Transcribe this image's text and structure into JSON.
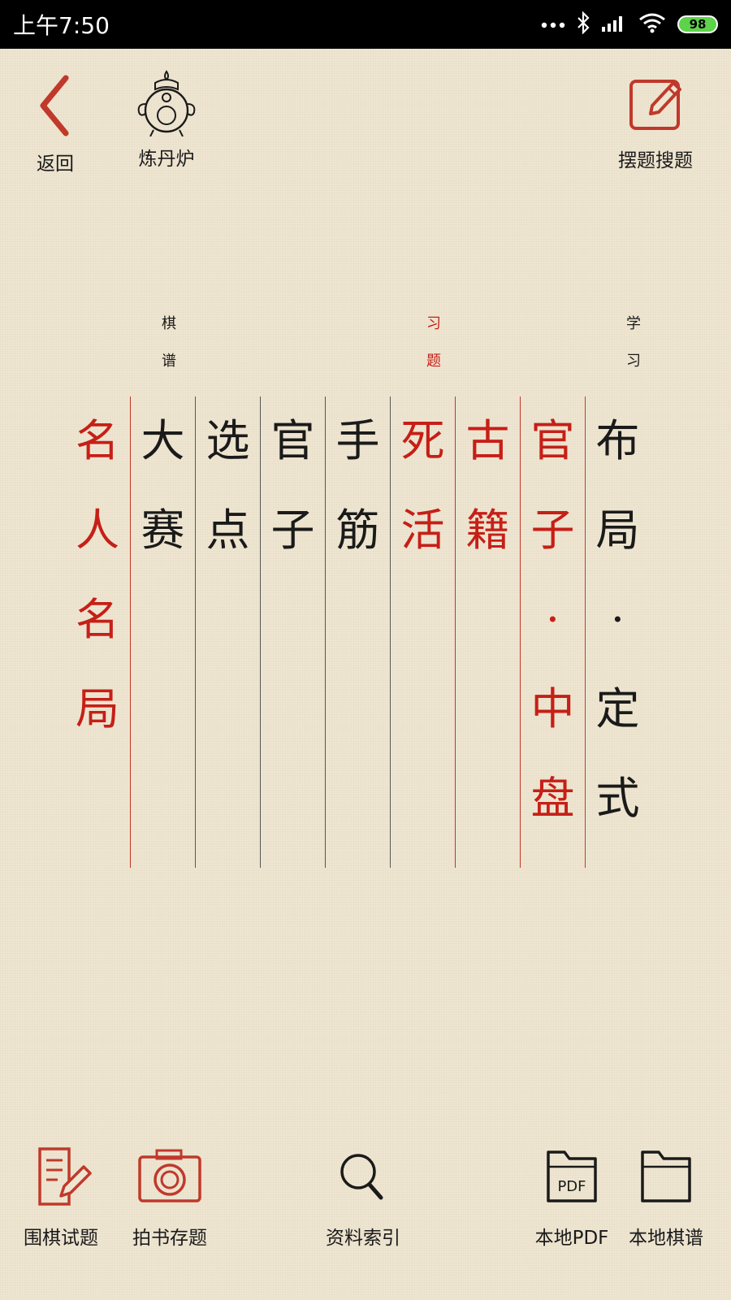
{
  "status_bar": {
    "time": "上午7:50",
    "battery": "98"
  },
  "header": {
    "back_label": "返回",
    "furnace_label": "炼丹炉",
    "search_label": "摆题搜题"
  },
  "menu": {
    "labels": {
      "qipu": [
        "棋",
        "谱"
      ],
      "xiti": [
        "习",
        "题"
      ],
      "xuexi": [
        "学",
        "习"
      ]
    },
    "columns": [
      {
        "chars": [
          "名",
          "人",
          "名",
          "局"
        ],
        "color": "red"
      },
      {
        "chars": [
          "大",
          "赛"
        ],
        "color": "black"
      },
      {
        "chars": [
          "选",
          "点"
        ],
        "color": "black"
      },
      {
        "chars": [
          "官",
          "子"
        ],
        "color": "black"
      },
      {
        "chars": [
          "手",
          "筋"
        ],
        "color": "black"
      },
      {
        "chars": [
          "死",
          "活"
        ],
        "color": "red"
      },
      {
        "chars": [
          "古",
          "籍"
        ],
        "color": "red"
      },
      {
        "chars": [
          "官",
          "子",
          "·",
          "中",
          "盘"
        ],
        "color": "red"
      },
      {
        "chars": [
          "布",
          "局",
          "·",
          "定",
          "式"
        ],
        "color": "black"
      }
    ]
  },
  "bottom_bar": {
    "items": [
      {
        "label": "围棋试题"
      },
      {
        "label": "拍书存题"
      },
      {
        "label": "资料索引"
      },
      {
        "label": "本地PDF",
        "pdf_text": "PDF"
      },
      {
        "label": "本地棋谱"
      }
    ]
  },
  "colors": {
    "accent": "#c61f17",
    "ink": "#1a1a1a",
    "paper": "#efe6d2"
  }
}
